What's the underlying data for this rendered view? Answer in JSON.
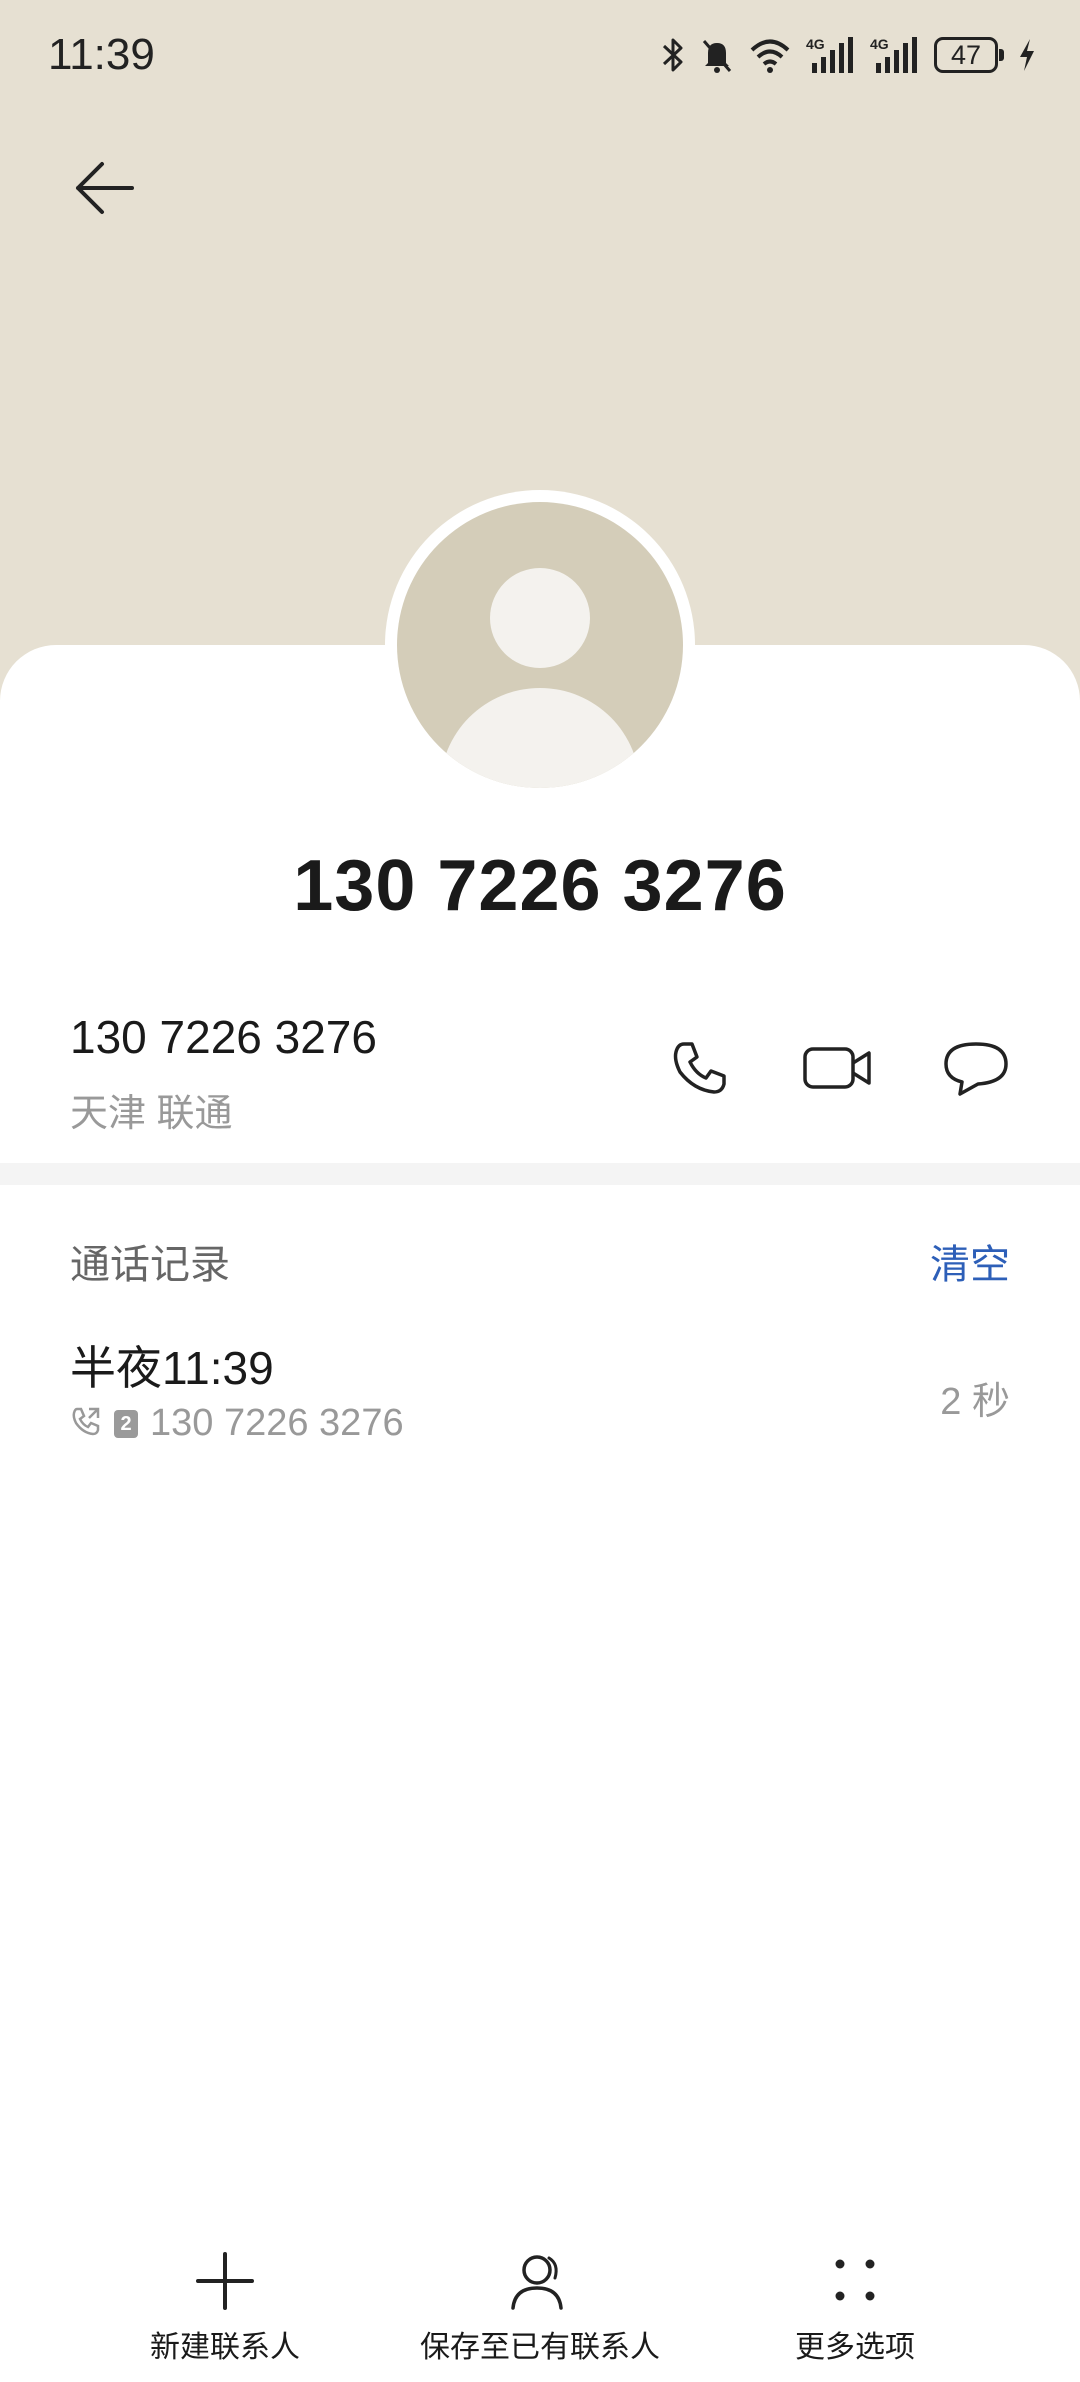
{
  "status_bar": {
    "time": "11:39",
    "battery": "47",
    "icons": [
      "bluetooth-icon",
      "mute-bell-icon",
      "wifi-icon",
      "signal-4g-icon",
      "signal-4g-icon",
      "battery-icon",
      "charging-icon"
    ]
  },
  "header": {
    "back_icon": "arrow-left-icon",
    "background_color": "#e6e0d2"
  },
  "contact": {
    "display_number": "130 7226 3276",
    "avatar_icon": "person-avatar-icon"
  },
  "phone_row": {
    "number": "130 7226 3276",
    "location": "天津 联通",
    "actions": [
      "phone-icon",
      "video-call-icon",
      "message-icon"
    ]
  },
  "call_log": {
    "title": "通话记录",
    "clear_label": "清空",
    "accent_color": "#2d5fb8",
    "entries": [
      {
        "time": "半夜11:39",
        "sim": "2",
        "number": "130 7226 3276",
        "duration": "2 秒"
      }
    ]
  },
  "bottom_nav": {
    "items": [
      {
        "label": "新建联系人",
        "icon": "plus-icon"
      },
      {
        "label": "保存至已有联系人",
        "icon": "person-icon"
      },
      {
        "label": "更多选项",
        "icon": "more-dots-icon"
      }
    ]
  }
}
